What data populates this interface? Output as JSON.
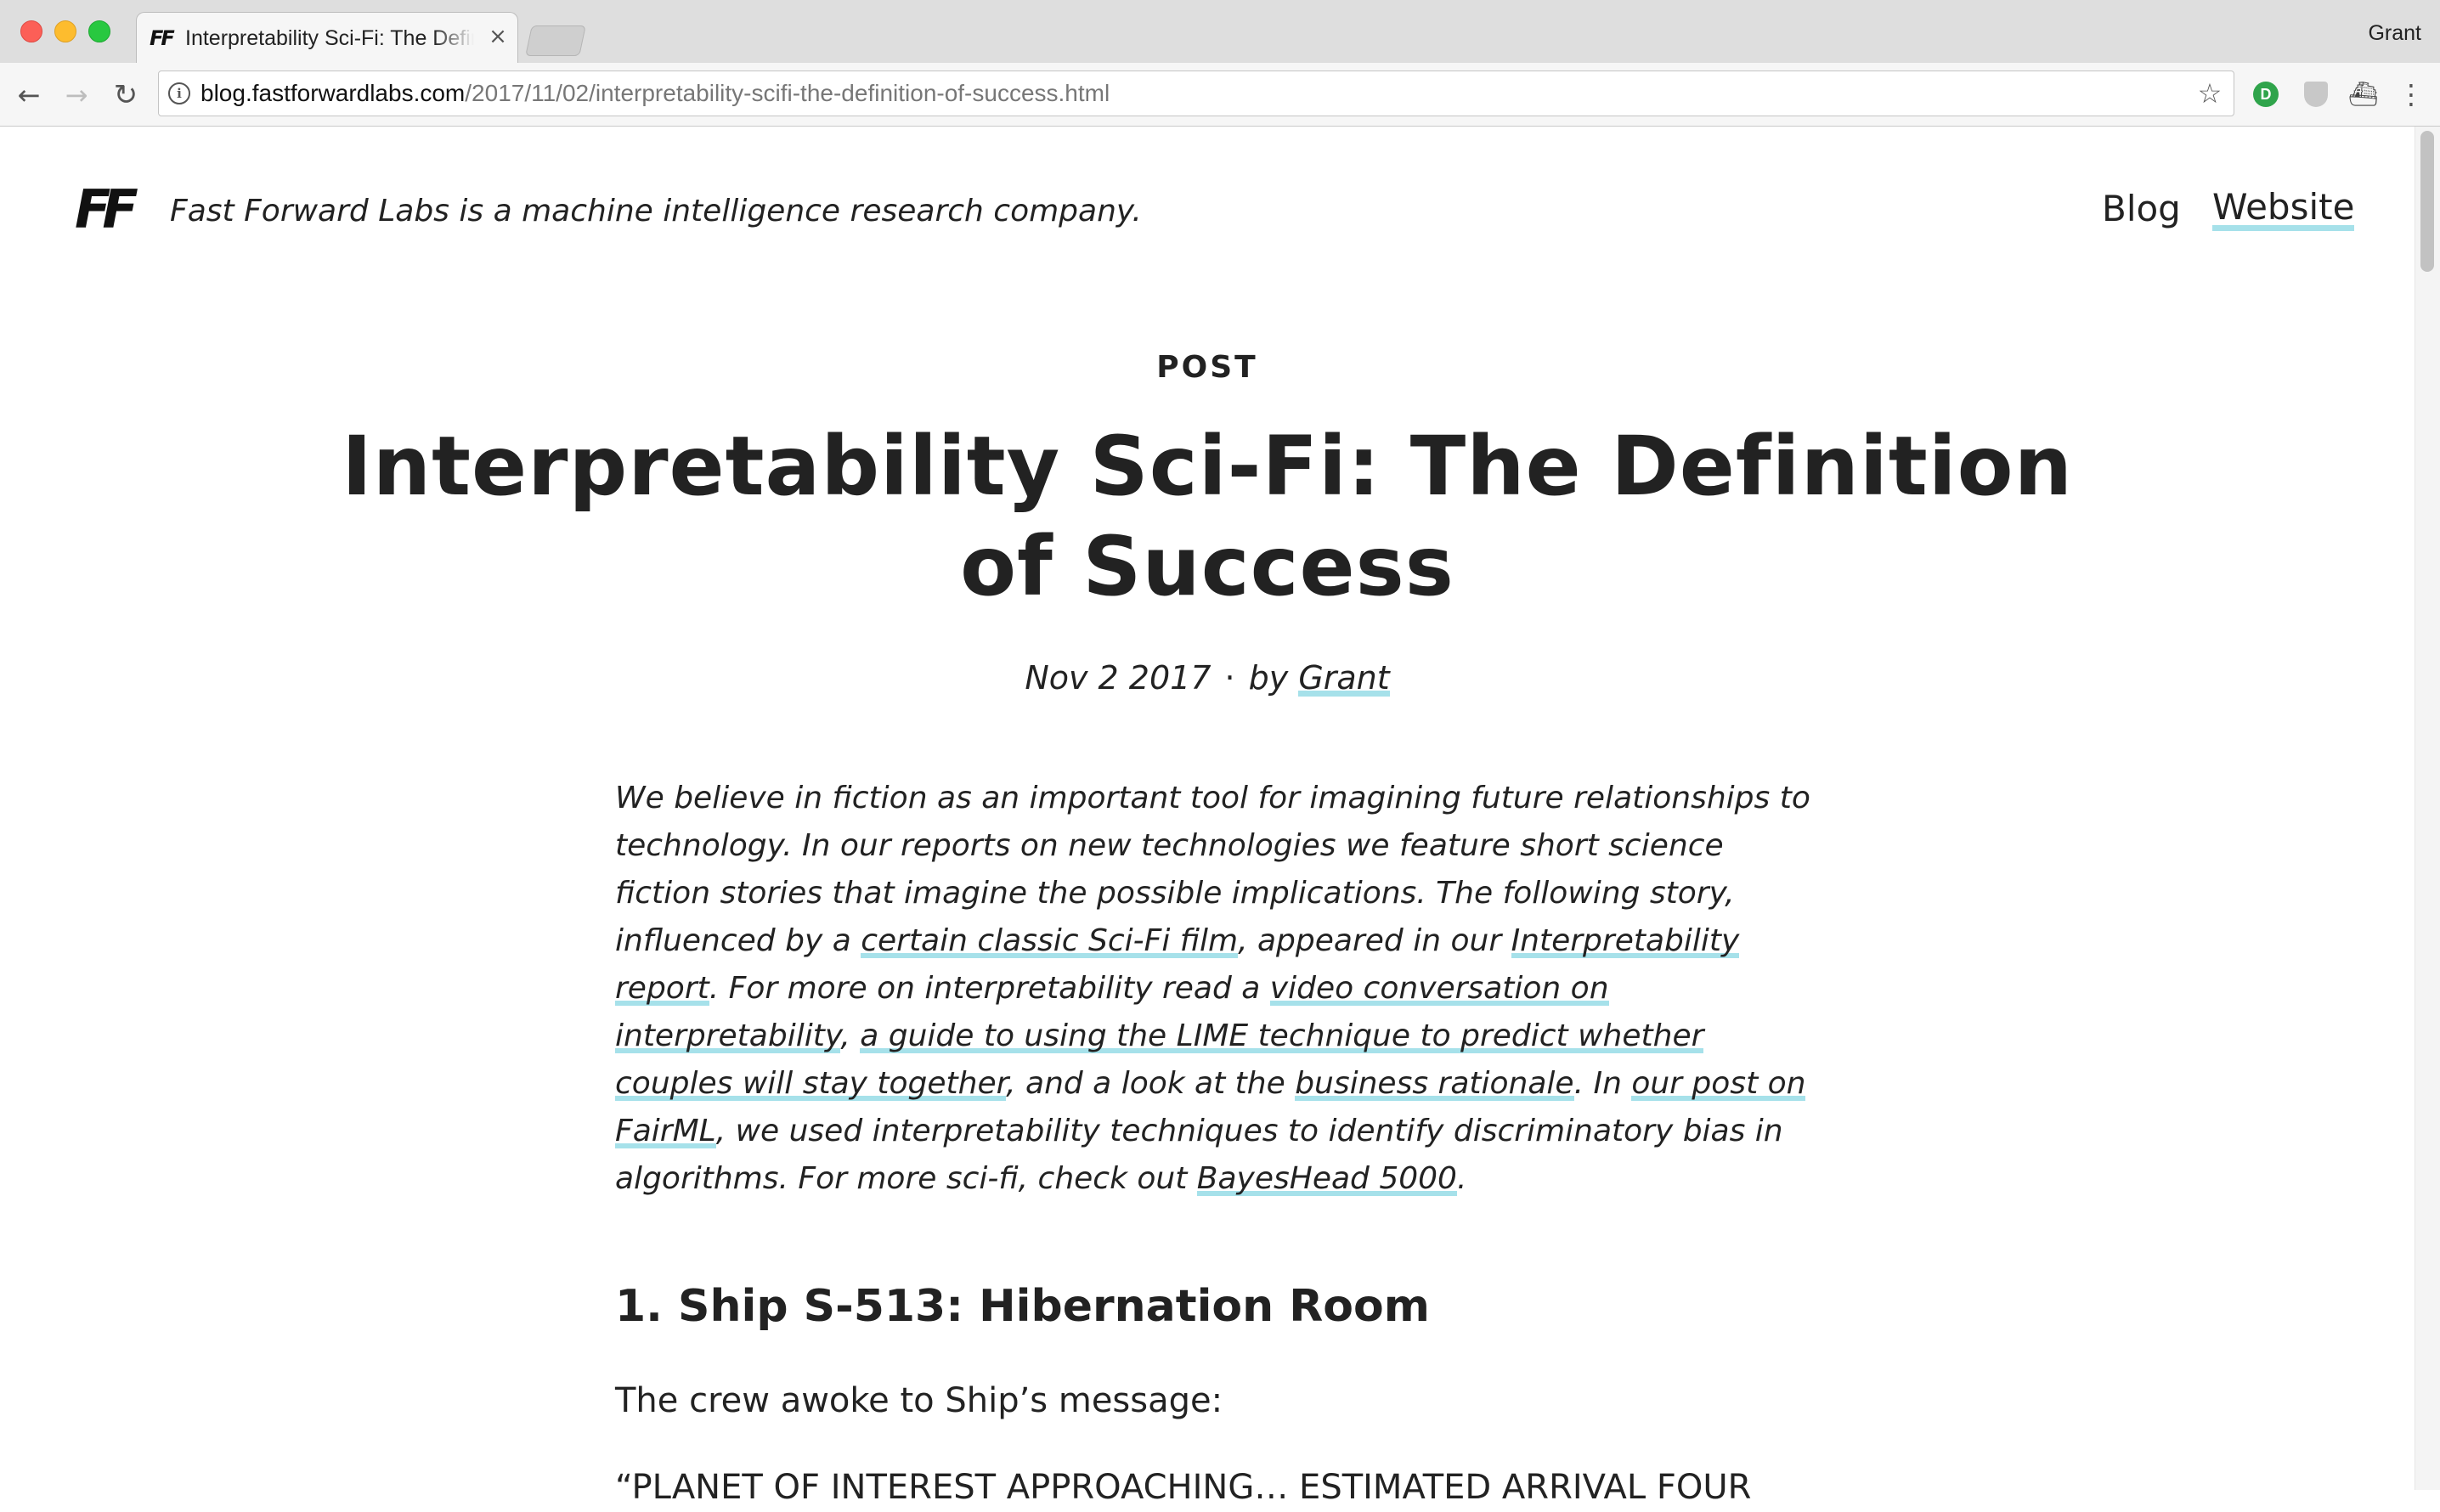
{
  "browser": {
    "tab_title": "Interpretability Sci-Fi: The Definition of Success",
    "tab_favicon": "FF",
    "tab_close": "×",
    "profile_name": "Grant",
    "url_host": "blog.fastforwardlabs.com",
    "url_path": "/2017/11/02/interpretability-scifi-the-definition-of-success.html",
    "icons": {
      "back": "back-arrow-icon",
      "forward": "forward-arrow-icon",
      "reload": "reload-icon",
      "info": "info-icon",
      "bookmark": "star-icon",
      "ext1": "extension-green-icon",
      "ext2": "extension-shield-icon",
      "ext3": "extension-dark-icon",
      "menu": "kebab-menu-icon"
    },
    "glyphs": {
      "back": "←",
      "forward": "→",
      "reload": "↻",
      "info": "i",
      "star": "☆",
      "ext1": "D",
      "menu": "⋮",
      "ext3": "⛴"
    }
  },
  "site": {
    "logo": "FF",
    "tagline": "Fast Forward Labs is a machine intelligence research company.",
    "nav": {
      "blog": "Blog",
      "website": "Website"
    }
  },
  "post": {
    "label": "POST",
    "title": "Interpretability Sci-Fi: The Definition of Success",
    "date": "Nov 2 2017",
    "separator": "·",
    "by": "by",
    "author": "Grant",
    "intro": {
      "t1": "We believe in fiction as an important tool for imagining future relationships to technology. In our reports on new technologies we feature short science fiction stories that imagine the possible implications. The following story, influenced by a ",
      "l1": "certain classic Sci-Fi film",
      "t2": ", appeared in our ",
      "l2": "Interpretability report",
      "t3": ". For more on interpretability read a ",
      "l3": "video conversation on interpretability",
      "t4": ", ",
      "l4": "a guide to using the LIME technique to predict whether couples will stay together",
      "t5": ", and a look at the ",
      "l5": "business rationale",
      "t6": ". In ",
      "l6": "our post on FairML",
      "t7": ", we used interpretability techniques to identify discriminatory bias in algorithms. For more sci-fi, check out ",
      "l7": "BayesHead 5000",
      "t8": "."
    },
    "section1_heading": "1. Ship S-513: Hibernation Room",
    "paragraph1": "The crew awoke to Ship’s message:",
    "paragraph2_partial": "“PLANET OF INTEREST APPROACHING… ESTIMATED ARRIVAL FOUR"
  },
  "colors": {
    "link_underline": "#a6e1ea",
    "text": "#222222",
    "chrome_bg": "#dedede"
  }
}
